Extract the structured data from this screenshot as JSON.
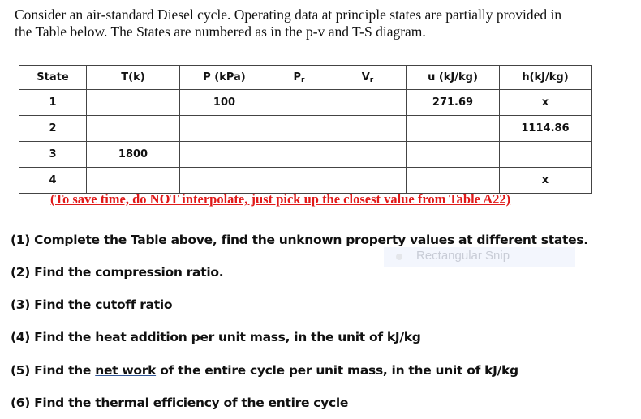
{
  "intro": {
    "line1": "Consider an air-standard Diesel cycle. Operating data at principle states are partially provided in",
    "line2": "the Table below. The States are numbered as in the p-v and T-S diagram."
  },
  "table": {
    "headers": {
      "state": "State",
      "T": "T(k)",
      "P": "P (kPa)",
      "Pr_main": "P",
      "Pr_sub": "r",
      "Vr_main": "V",
      "Vr_sub": "r",
      "u": "u (kJ/kg)",
      "h": "h(kJ/kg)"
    },
    "rows": [
      {
        "state": "1",
        "T": "",
        "P": "100",
        "Pr": "",
        "Vr": "",
        "u": "271.69",
        "h": "x"
      },
      {
        "state": "2",
        "T": "",
        "P": "",
        "Pr": "",
        "Vr": "",
        "u": "",
        "h": "1114.86"
      },
      {
        "state": "3",
        "T": "1800",
        "P": "",
        "Pr": "",
        "Vr": "",
        "u": "",
        "h": ""
      },
      {
        "state": "4",
        "T": "",
        "P": "",
        "Pr": "",
        "Vr": "",
        "u": "",
        "h": "x"
      }
    ]
  },
  "note": "(To save time, do NOT interpolate, just pick up the closest value from Table A22)",
  "questions": {
    "q1": "(1) Complete the Table above, find the unknown property values at different states.",
    "q2": "(2) Find the compression ratio.",
    "q3": "(3) Find the cutoff ratio",
    "q4": "(4) Find the heat addition per unit mass, in the unit of kJ/kg",
    "q5_pre": "(5) Find the ",
    "q5_link": "net work",
    "q5_post": " of the entire cycle per unit mass, in the unit of kJ/kg",
    "q6": "(6) Find the thermal efficiency of the entire cycle"
  },
  "snip_tooltip": {
    "icon": "record-dot-icon",
    "label": "Rectangular Snip"
  },
  "colors": {
    "note_red": "#e01a1a",
    "underline_blue": "#2f5597"
  }
}
